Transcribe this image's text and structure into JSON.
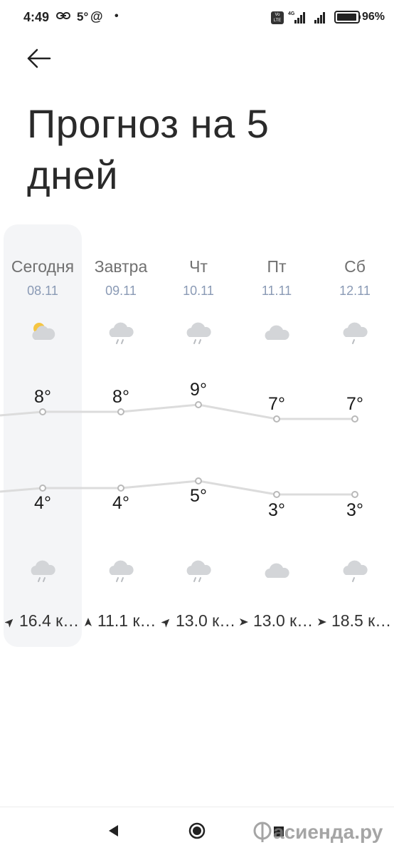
{
  "status_bar": {
    "time": "4:49",
    "temp": "5°",
    "at": "@",
    "dot": "•",
    "network": "4G",
    "battery": "96%"
  },
  "header": {
    "title": "Прогноз на 5 дней"
  },
  "days": [
    {
      "name": "Сегодня",
      "date": "08.11",
      "day_icon": "partly-cloudy-icon",
      "high": "8°",
      "low": "4°",
      "night_icon": "rain-icon",
      "wind": "16.4 к…",
      "wind_icon": "wind-direction-arrow-icon"
    },
    {
      "name": "Завтра",
      "date": "09.11",
      "day_icon": "rain-icon",
      "high": "8°",
      "low": "4°",
      "night_icon": "rain-icon",
      "wind": "11.1 к…",
      "wind_icon": "wind-direction-arrow-icon"
    },
    {
      "name": "Чт",
      "date": "10.11",
      "day_icon": "rain-icon",
      "high": "9°",
      "low": "5°",
      "night_icon": "rain-icon",
      "wind": "13.0 к…",
      "wind_icon": "wind-direction-arrow-icon"
    },
    {
      "name": "Пт",
      "date": "11.11",
      "day_icon": "cloud-icon",
      "high": "7°",
      "low": "3°",
      "night_icon": "cloud-icon",
      "wind": "13.0 к…",
      "wind_icon": "wind-direction-arrow-icon"
    },
    {
      "name": "Сб",
      "date": "12.11",
      "day_icon": "rain-icon",
      "high": "7°",
      "low": "3°",
      "night_icon": "rain-icon",
      "wind": "18.5 к…",
      "wind_icon": "wind-direction-arrow-icon"
    }
  ],
  "nav": {
    "watermark": "асиенда.ру"
  },
  "colors": {
    "accent_date": "#8a9ab5",
    "line": "#dcdcdc",
    "highlight": "#f4f5f7",
    "cloud": "#d3d5d8",
    "sun": "#f5c542"
  }
}
